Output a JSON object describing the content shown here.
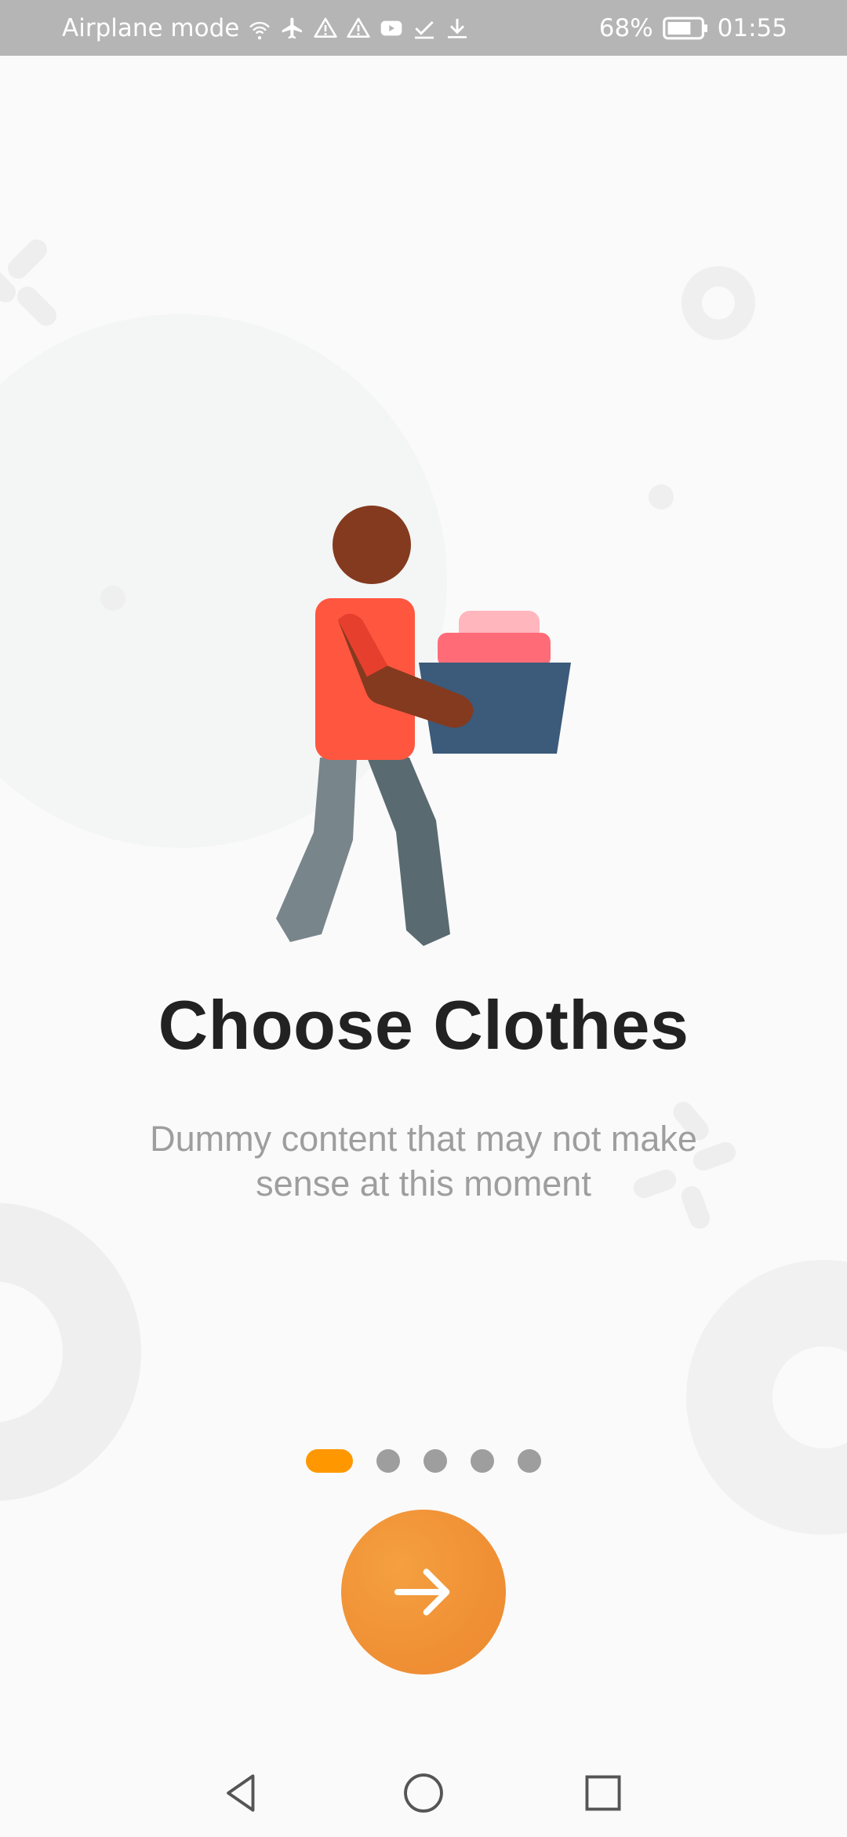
{
  "status_bar": {
    "left_text": "Airplane mode",
    "battery": "68%",
    "time": "01:55",
    "icons": [
      "wifi-icon",
      "airplane-icon",
      "warning-icon",
      "warning-icon",
      "youtube-icon",
      "check-icon",
      "download-icon",
      "battery-icon"
    ]
  },
  "onboarding": {
    "title": "Choose Clothes",
    "subtitle": "Dummy content that may not make sense at this moment",
    "page_count": 5,
    "active_page": 1,
    "accent_color": "#ff9800",
    "button_color": "#f09035",
    "next_icon": "arrow-right-icon"
  },
  "nav_bar": {
    "back_icon": "back-triangle-icon",
    "home_icon": "home-circle-icon",
    "recents_icon": "recents-square-icon"
  }
}
